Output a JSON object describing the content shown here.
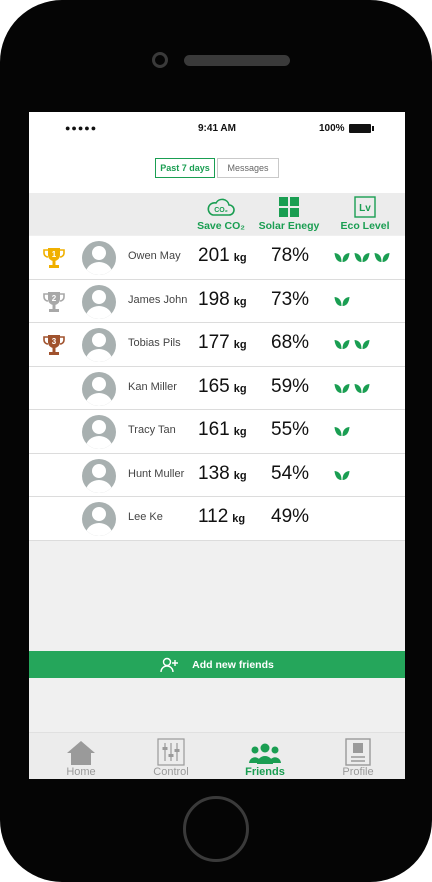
{
  "status_bar": {
    "signal": "●●●●● ",
    "time": "9:41 AM",
    "battery": "100%"
  },
  "segments": [
    {
      "label": "Past 7 days",
      "active": true
    },
    {
      "label": "Messages",
      "active": false
    }
  ],
  "columns": {
    "save": "Save CO₂",
    "solar": "Solar Enegy",
    "eco": "Eco Level",
    "co2_icon_text": "CO₂",
    "lv_icon_text": "Lv"
  },
  "trophy_colors": {
    "1": "#f0b000",
    "2": "#a8a8a8",
    "3": "#a0522d"
  },
  "leaf_color": "#1a9e52",
  "unit": "kg",
  "rows": [
    {
      "rank": "1",
      "name": "Owen May",
      "saved": "201",
      "solar": "78%",
      "eco": 3
    },
    {
      "rank": "2",
      "name": "James John",
      "saved": "198",
      "solar": "73%",
      "eco": 1
    },
    {
      "rank": "3",
      "name": "Tobias Pils",
      "saved": "177",
      "solar": "68%",
      "eco": 2
    },
    {
      "rank": "",
      "name": "Kan Miller",
      "saved": "165",
      "solar": "59%",
      "eco": 2
    },
    {
      "rank": "",
      "name": "Tracy Tan",
      "saved": "161",
      "solar": "55%",
      "eco": 1
    },
    {
      "rank": "",
      "name": "Hunt Muller",
      "saved": "138",
      "solar": "54%",
      "eco": 1
    },
    {
      "rank": "",
      "name": "Lee Ke",
      "saved": "112",
      "solar": "49%",
      "eco": 0
    }
  ],
  "add_friends": {
    "label": "Add new friends",
    "icon": "add-user-icon"
  },
  "tabs": [
    {
      "label": "Home",
      "icon": "home-icon",
      "active": false
    },
    {
      "label": "Control",
      "icon": "sliders-icon",
      "active": false
    },
    {
      "label": "Friends",
      "icon": "friends-icon",
      "active": true
    },
    {
      "label": "Profile",
      "icon": "profile-icon",
      "active": false
    }
  ],
  "accent_color": "#1a9e52"
}
